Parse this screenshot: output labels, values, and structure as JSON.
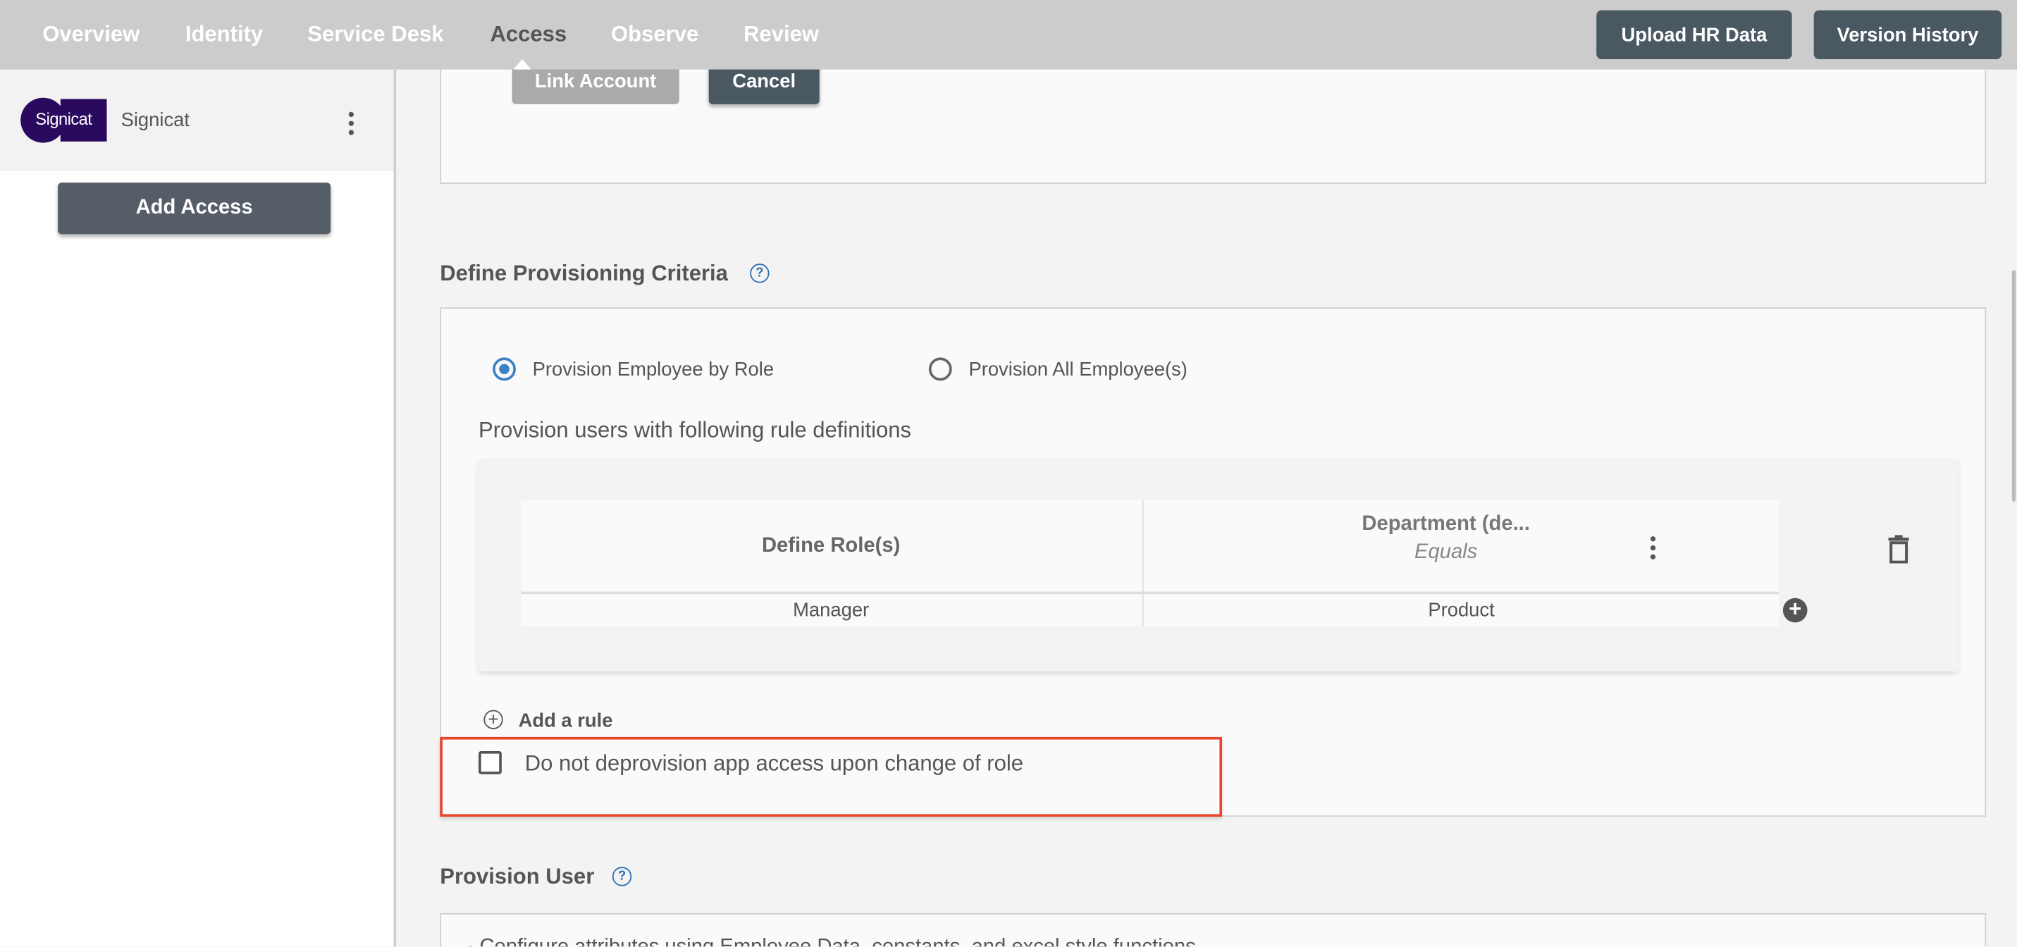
{
  "nav": {
    "items": [
      {
        "label": "Overview",
        "active": false
      },
      {
        "label": "Identity",
        "active": false
      },
      {
        "label": "Service Desk",
        "active": false
      },
      {
        "label": "Access",
        "active": true
      },
      {
        "label": "Observe",
        "active": false
      },
      {
        "label": "Review",
        "active": false
      }
    ],
    "upload_label": "Upload HR Data",
    "version_label": "Version History"
  },
  "sidebar": {
    "app_logo_text": "Signicat",
    "app_name": "Signicat",
    "add_access_label": "Add Access"
  },
  "account_card": {
    "link_label": "Link Account",
    "cancel_label": "Cancel"
  },
  "criteria": {
    "title": "Define Provisioning Criteria",
    "help_glyph": "?",
    "radio_by_role": "Provision Employee by Role",
    "radio_all": "Provision All Employee(s)",
    "selected": "Provision Employee by Role",
    "rules_heading": "Provision users with following rule definitions",
    "table": {
      "col1_header": "Define Role(s)",
      "col2_header": "Department (de...",
      "col2_operator": "Equals",
      "rows": [
        {
          "role": "Manager",
          "department": "Product"
        }
      ]
    },
    "add_rule_label": "Add a rule",
    "no_deprovision_label": "Do not deprovision app access upon change of role",
    "no_deprovision_checked": false
  },
  "provision_user": {
    "title": "Provision User",
    "help_glyph": "?",
    "description": "Configure attributes using Employee Data, constants, and excel style functions"
  },
  "colors": {
    "highlight": "#e8452c",
    "accent": "#3b82c4",
    "button_dark": "#4a5862",
    "logo": "#2a0a5e"
  }
}
